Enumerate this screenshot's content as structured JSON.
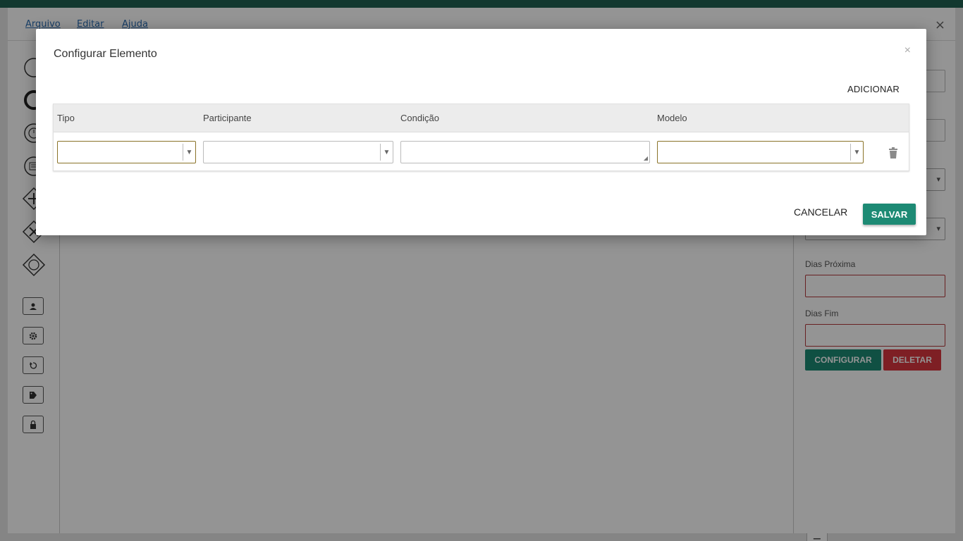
{
  "app": {
    "menu": [
      "Arquivo",
      "Editar",
      "Ajuda"
    ],
    "close_symbol": "×",
    "accent_color": "#1d8a74",
    "danger_color": "#d9363e"
  },
  "palette": {
    "tools": [
      "start-event-icon",
      "end-event-icon",
      "timer-event-icon",
      "message-event-icon",
      "parallel-gateway-icon",
      "exclusive-gateway-icon",
      "event-gateway-icon",
      "user-task-icon",
      "service-task-icon",
      "loop-task-icon",
      "tag-task-icon",
      "lock-task-icon"
    ]
  },
  "properties": {
    "labels": {
      "dias_proxima": "Dias Próxima",
      "dias_fim": "Dias Fim"
    },
    "configure_label": "CONFIGURAR",
    "delete_label": "DELETAR"
  },
  "canvas": {
    "zoom": {
      "zoom_in": "+",
      "zoom_out": "−"
    }
  },
  "modal": {
    "title": "Configurar Elemento",
    "close_symbol": "×",
    "add_label": "ADICIONAR",
    "columns": [
      "Tipo",
      "Participante",
      "Condição",
      "Modelo"
    ],
    "row": {
      "tipo": "",
      "participante": "",
      "condicao": "",
      "modelo": ""
    },
    "cancel_label": "CANCELAR",
    "save_label": "SALVAR"
  }
}
